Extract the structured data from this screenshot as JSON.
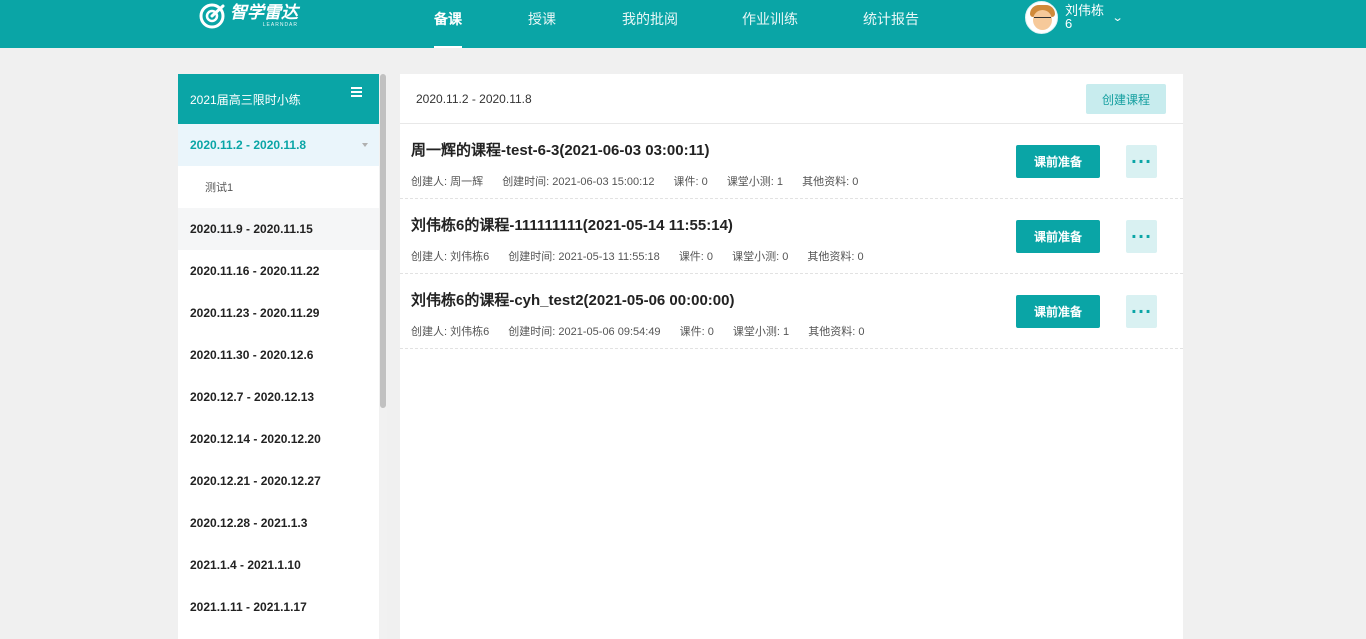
{
  "header": {
    "logo_text": "智学雷达",
    "logo_sub": "LEARNDAR",
    "nav": [
      {
        "label": "备课",
        "active": true
      },
      {
        "label": "授课",
        "active": false
      },
      {
        "label": "我的批阅",
        "active": false
      },
      {
        "label": "作业训练",
        "active": false
      },
      {
        "label": "统计报告",
        "active": false
      }
    ],
    "user_name": "刘伟栋6",
    "accent_color": "#0aa5a6"
  },
  "sidebar": {
    "title": "2021届高三限时小练",
    "weeks": [
      {
        "label": "2020.11.2 - 2020.11.8",
        "expanded": true,
        "children": [
          "测试1"
        ]
      },
      {
        "label": "2020.11.9 - 2020.11.15"
      },
      {
        "label": "2020.11.16 - 2020.11.22"
      },
      {
        "label": "2020.11.23 - 2020.11.29"
      },
      {
        "label": "2020.11.30 - 2020.12.6"
      },
      {
        "label": "2020.12.7 - 2020.12.13"
      },
      {
        "label": "2020.12.14 - 2020.12.20"
      },
      {
        "label": "2020.12.21 - 2020.12.27"
      },
      {
        "label": "2020.12.28 - 2021.1.3"
      },
      {
        "label": "2021.1.4 - 2021.1.10"
      },
      {
        "label": "2021.1.11 - 2021.1.17"
      }
    ]
  },
  "main": {
    "range": "2020.11.2 - 2020.11.8",
    "create_label": "创建课程",
    "prep_label": "课前准备",
    "more_label": "···",
    "courses": [
      {
        "title": "周一辉的课程-test-6-3(2021-06-03 03:00:11)",
        "creator": "创建人: 周一辉",
        "created": "创建时间: 2021-06-03 15:00:12",
        "coursewares": "课件: 0",
        "quizzes": "课堂小测: 1",
        "others": "其他资料: 0"
      },
      {
        "title": "刘伟栋6的课程-111111111(2021-05-14 11:55:14)",
        "creator": "创建人: 刘伟栋6",
        "created": "创建时间: 2021-05-13 11:55:18",
        "coursewares": "课件: 0",
        "quizzes": "课堂小测: 0",
        "others": "其他资料: 0"
      },
      {
        "title": "刘伟栋6的课程-cyh_test2(2021-05-06 00:00:00)",
        "creator": "创建人: 刘伟栋6",
        "created": "创建时间: 2021-05-06 09:54:49",
        "coursewares": "课件: 0",
        "quizzes": "课堂小测: 1",
        "others": "其他资料: 0"
      }
    ]
  }
}
